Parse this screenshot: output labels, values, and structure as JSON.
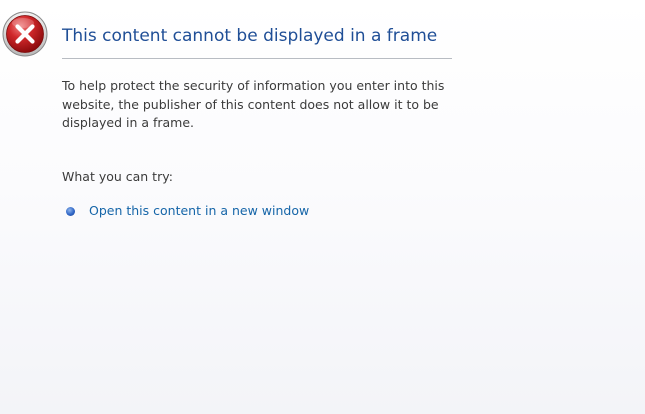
{
  "page": {
    "icon": "error-x-icon",
    "title": "This content cannot be displayed in a frame",
    "description": "To help protect the security of information you enter into this website, the publisher of this content does not allow it to be displayed in a frame.",
    "try_label": "What you can try:",
    "options": [
      {
        "label": "Open this content in a new window",
        "bullet_icon": "bullet-icon"
      }
    ]
  },
  "colors": {
    "title": "#1f4e96",
    "link": "#1565a8",
    "body_text": "#3b3b3b",
    "error_red": "#c62828"
  }
}
